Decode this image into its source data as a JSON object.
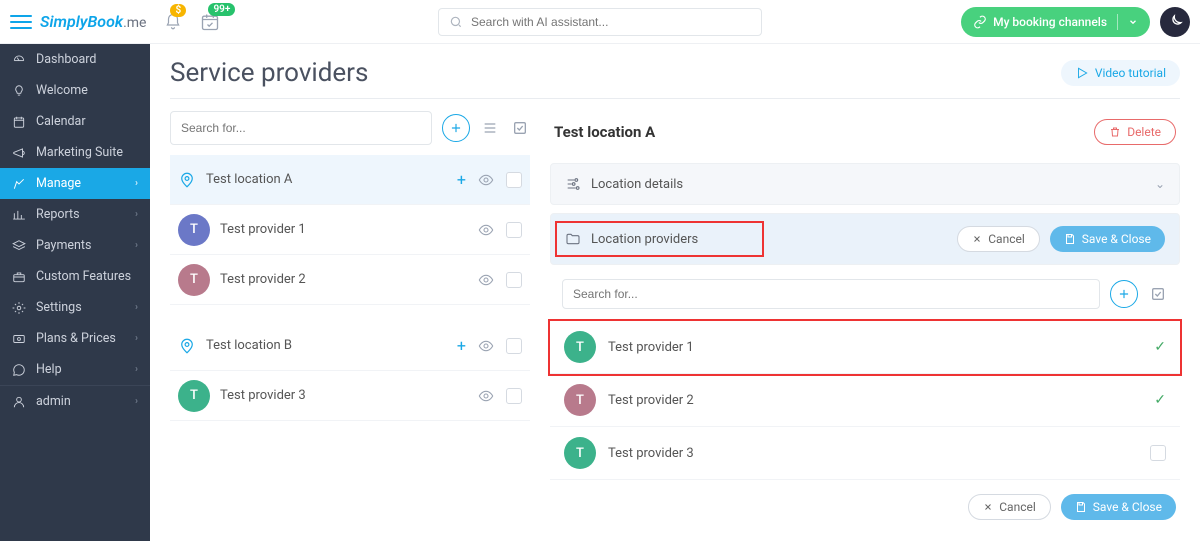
{
  "top": {
    "logo1": "SimplyBook",
    "logo2": ".me",
    "search_placeholder": "Search with AI assistant...",
    "badge_bell": "$",
    "badge_cal": "99+",
    "booking_label": "My booking channels"
  },
  "sidebar": {
    "items": [
      {
        "id": "dashboard",
        "label": "Dashboard",
        "chev": false
      },
      {
        "id": "welcome",
        "label": "Welcome",
        "chev": false
      },
      {
        "id": "calendar",
        "label": "Calendar",
        "chev": false
      },
      {
        "id": "marketing",
        "label": "Marketing Suite",
        "chev": false
      },
      {
        "id": "manage",
        "label": "Manage",
        "chev": true
      },
      {
        "id": "reports",
        "label": "Reports",
        "chev": true
      },
      {
        "id": "payments",
        "label": "Payments",
        "chev": true
      },
      {
        "id": "custom",
        "label": "Custom Features",
        "chev": false
      },
      {
        "id": "settings",
        "label": "Settings",
        "chev": true
      },
      {
        "id": "plans",
        "label": "Plans & Prices",
        "chev": true
      },
      {
        "id": "help",
        "label": "Help",
        "chev": true
      },
      {
        "id": "admin",
        "label": "admin",
        "chev": true
      }
    ]
  },
  "page": {
    "title": "Service providers",
    "video": "Video tutorial"
  },
  "left": {
    "search_placeholder": "Search for...",
    "locations": [
      {
        "name": "Test location A",
        "active": true,
        "providers": [
          {
            "name": "Test provider 1",
            "letter": "T",
            "color": "#6b78c7"
          },
          {
            "name": "Test provider 2",
            "letter": "T",
            "color": "#b87a8c"
          }
        ]
      },
      {
        "name": "Test location B",
        "active": false,
        "providers": [
          {
            "name": "Test provider 3",
            "letter": "T",
            "color": "#3cb28b"
          }
        ]
      }
    ]
  },
  "right": {
    "title": "Test location A",
    "delete_label": "Delete",
    "section_details": "Location details",
    "section_providers": "Location providers",
    "cancel_label": "Cancel",
    "save_label": "Save & Close",
    "search_placeholder": "Search for...",
    "providers": [
      {
        "name": "Test provider 1",
        "letter": "T",
        "color": "#3cb28b",
        "checked": true,
        "hl": true
      },
      {
        "name": "Test provider 2",
        "letter": "T",
        "color": "#b87a8c",
        "checked": true,
        "hl": false
      },
      {
        "name": "Test provider 3",
        "letter": "T",
        "color": "#3cb28b",
        "checked": false,
        "hl": false
      }
    ]
  }
}
